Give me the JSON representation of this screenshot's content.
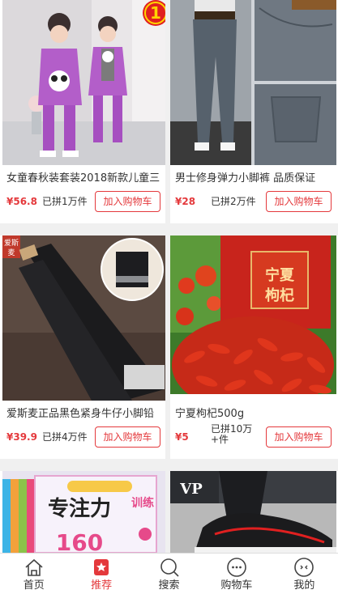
{
  "products": [
    {
      "title": "女童春秋装套装2018新款儿童三",
      "price": "¥56.8",
      "sold": "已拼1万件",
      "cart_label": "加入购物车",
      "badge": "1"
    },
    {
      "title": "男士修身弹力小脚裤 品质保证",
      "price": "¥28",
      "sold": "已拼2万件",
      "cart_label": "加入购物车"
    },
    {
      "title": "爱斯麦正品黑色紧身牛仔小脚铅",
      "price": "¥39.9",
      "sold": "已拼4万件",
      "cart_label": "加入购物车",
      "image_tag": "爱斯麦"
    },
    {
      "title": "宁夏枸杞500g",
      "price": "¥5",
      "sold_line1": "已拼10万",
      "sold_line2": "+件",
      "cart_label": "加入购物车",
      "package_text": "宁夏枸杞"
    },
    {
      "cover_text": "专注力",
      "cover_side": "训练",
      "cover_number": "160"
    },
    {
      "brand_text": "VP"
    }
  ],
  "tabbar": [
    {
      "label": "首页",
      "icon": "home-icon",
      "active": false
    },
    {
      "label": "推荐",
      "icon": "recommend-icon",
      "active": true
    },
    {
      "label": "搜索",
      "icon": "search-icon",
      "active": false
    },
    {
      "label": "购物车",
      "icon": "cart-icon",
      "active": false
    },
    {
      "label": "我的",
      "icon": "profile-icon",
      "active": false
    }
  ],
  "colors": {
    "accent": "#e4393c",
    "background": "#f0f0f0"
  }
}
